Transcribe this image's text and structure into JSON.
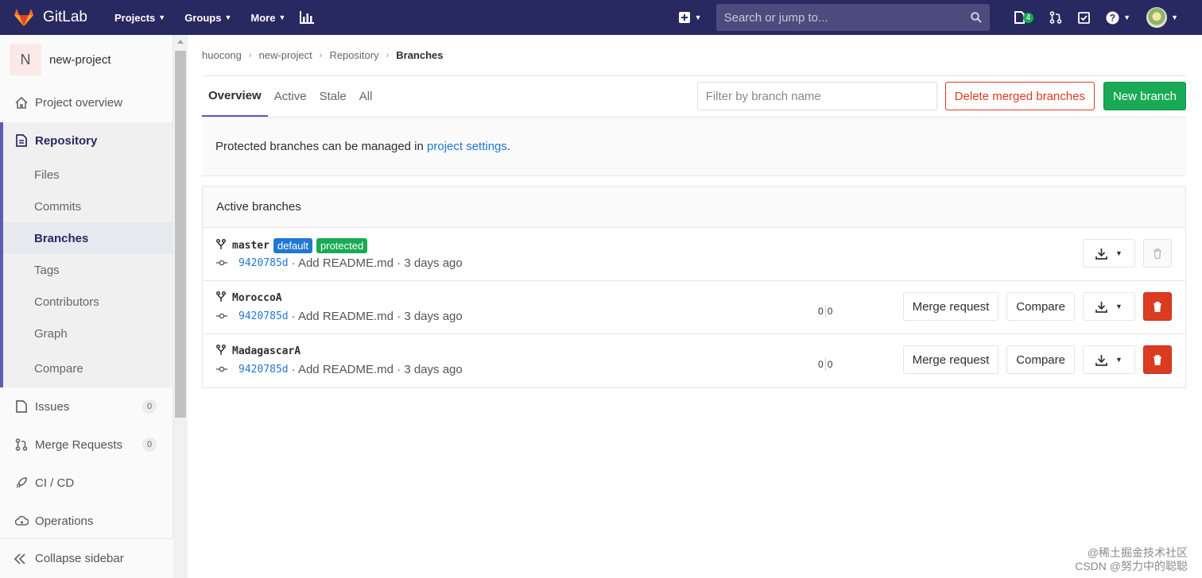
{
  "navbar": {
    "brand": "GitLab",
    "menu": [
      {
        "label": "Projects"
      },
      {
        "label": "Groups"
      },
      {
        "label": "More"
      }
    ],
    "search_placeholder": "Search or jump to...",
    "todo_count": "4"
  },
  "sidebar": {
    "project_initial": "N",
    "project_name": "new-project",
    "project_overview": "Project overview",
    "repository": "Repository",
    "repo_items": [
      "Files",
      "Commits",
      "Branches",
      "Tags",
      "Contributors",
      "Graph",
      "Compare"
    ],
    "issues": "Issues",
    "issues_count": "0",
    "merge_requests": "Merge Requests",
    "mr_count": "0",
    "cicd": "CI / CD",
    "operations": "Operations",
    "collapse": "Collapse sidebar"
  },
  "breadcrumb": [
    "huocong",
    "new-project",
    "Repository",
    "Branches"
  ],
  "tabs": [
    "Overview",
    "Active",
    "Stale",
    "All"
  ],
  "filter_placeholder": "Filter by branch name",
  "buttons": {
    "delete_merged": "Delete merged branches",
    "new_branch": "New branch",
    "merge_request": "Merge request",
    "compare": "Compare"
  },
  "notice": {
    "text": "Protected branches can be managed in ",
    "link": "project settings",
    "end": "."
  },
  "panel_title": "Active branches",
  "branches": [
    {
      "name": "master",
      "labels": [
        "default",
        "protected"
      ],
      "sha": "9420785d",
      "message": "· Add README.md · 3 days ago",
      "behind": "",
      "ahead": ""
    },
    {
      "name": "MoroccoA",
      "labels": [],
      "sha": "9420785d",
      "message": "· Add README.md · 3 days ago",
      "behind": "0",
      "ahead": "0"
    },
    {
      "name": "MadagascarA",
      "labels": [],
      "sha": "9420785d",
      "message": "· Add README.md · 3 days ago",
      "behind": "0",
      "ahead": "0"
    }
  ],
  "watermark": [
    "@稀土掘金技术社区",
    "CSDN @努力中的聪聪"
  ],
  "colors": {
    "navbar": "#292961",
    "success": "#1aaa55",
    "danger": "#db3b21",
    "link": "#1f78d1"
  }
}
